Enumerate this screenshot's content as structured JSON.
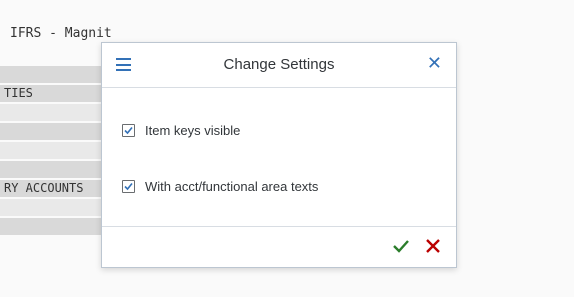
{
  "background": {
    "title": "IFRS - Magnit",
    "rows": [
      "",
      "TIES",
      "",
      "",
      "",
      "",
      "RY ACCOUNTS",
      "",
      ""
    ]
  },
  "dialog": {
    "title": "Change Settings",
    "menu_icon": "hamburger-menu-icon",
    "close_icon": "close-icon",
    "options": [
      {
        "label": "Item keys visible",
        "checked": true
      },
      {
        "label": "With acct/functional area texts",
        "checked": true
      }
    ],
    "footer": {
      "ok_icon": "checkmark-icon",
      "cancel_icon": "cancel-x-icon"
    }
  },
  "colors": {
    "accent_blue": "#3371b7",
    "ok_green": "#2b7d2b",
    "cancel_red": "#bb0000"
  }
}
